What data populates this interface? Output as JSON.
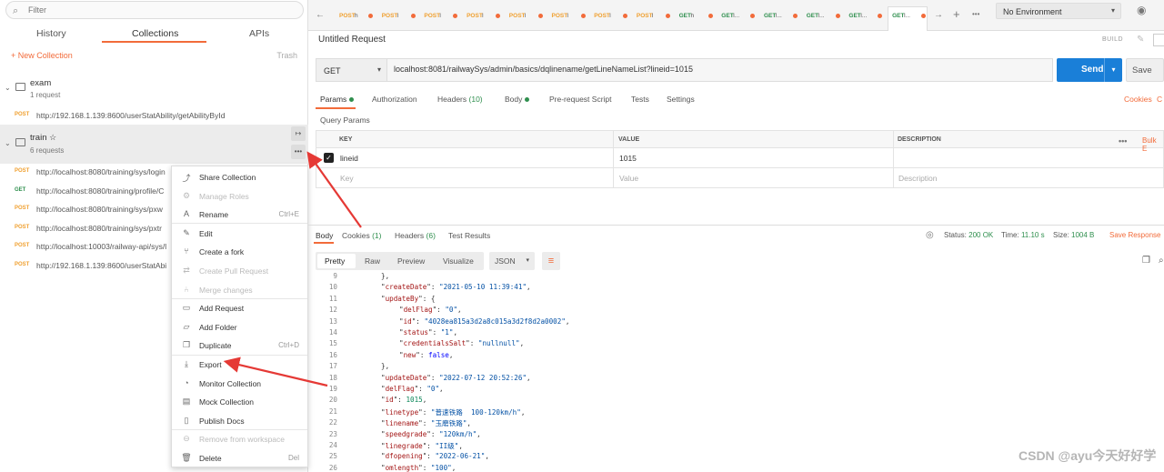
{
  "sidebar": {
    "filter_placeholder": "Filter",
    "tabs": [
      "History",
      "Collections",
      "APIs"
    ],
    "new_collection": "+ New Collection",
    "trash": "Trash",
    "collections": [
      {
        "name": "exam",
        "requests": "1 request"
      },
      {
        "name": "train",
        "star": "☆",
        "requests": "6 requests"
      }
    ],
    "exam_request": {
      "method": "POST",
      "url": "http://192.168.1.139:8600/userStatAbility/getAbilityById"
    },
    "train_requests": [
      {
        "method": "POST",
        "url": "http://localhost:8080/training/sys/login"
      },
      {
        "method": "GET",
        "url": "http://localhost:8080/training/profile/C"
      },
      {
        "method": "POST",
        "url": "http://localhost:8080/training/sys/pxw"
      },
      {
        "method": "POST",
        "url": "http://localhost:8080/training/sys/pxtr"
      },
      {
        "method": "POST",
        "url": "http://localhost:10003/railway-api/sys/l"
      },
      {
        "method": "POST",
        "url": "http://192.168.1.139:8600/userStatAbi"
      }
    ]
  },
  "context_menu": [
    {
      "label": "Share Collection",
      "icon": "share-icon",
      "glyph": "⤴",
      "shortcut": "",
      "disabled": false
    },
    {
      "label": "Manage Roles",
      "icon": "roles-icon",
      "glyph": "⚙",
      "shortcut": "",
      "disabled": true
    },
    {
      "label": "Rename",
      "icon": "rename-icon",
      "glyph": "A",
      "shortcut": "Ctrl+E",
      "disabled": false
    },
    {
      "label": "Edit",
      "icon": "pencil-icon",
      "glyph": "✎",
      "shortcut": "",
      "disabled": false
    },
    {
      "label": "Create a fork",
      "icon": "fork-icon",
      "glyph": "⑂",
      "shortcut": "",
      "disabled": false
    },
    {
      "label": "Create Pull Request",
      "icon": "pull-request-icon",
      "glyph": "⇄",
      "shortcut": "",
      "disabled": true
    },
    {
      "label": "Merge changes",
      "icon": "merge-icon",
      "glyph": "⑃",
      "shortcut": "",
      "disabled": true
    },
    {
      "label": "Add Request",
      "icon": "add-request-icon",
      "glyph": "▭",
      "shortcut": "",
      "disabled": false
    },
    {
      "label": "Add Folder",
      "icon": "add-folder-icon",
      "glyph": "▱",
      "shortcut": "",
      "disabled": false
    },
    {
      "label": "Duplicate",
      "icon": "duplicate-icon",
      "glyph": "❐",
      "shortcut": "Ctrl+D",
      "disabled": false
    },
    {
      "label": "Export",
      "icon": "export-icon",
      "glyph": "⤓",
      "shortcut": "",
      "disabled": false
    },
    {
      "label": "Monitor Collection",
      "icon": "monitor-icon",
      "glyph": "◔",
      "shortcut": "",
      "disabled": false
    },
    {
      "label": "Mock Collection",
      "icon": "mock-icon",
      "glyph": "▤",
      "shortcut": "",
      "disabled": false
    },
    {
      "label": "Publish Docs",
      "icon": "docs-icon",
      "glyph": "▯",
      "shortcut": "",
      "disabled": false
    },
    {
      "label": "Remove from workspace",
      "icon": "remove-icon",
      "glyph": "⊖",
      "shortcut": "",
      "disabled": true
    },
    {
      "label": "Delete",
      "icon": "trash-icon",
      "glyph": "🗑",
      "shortcut": "Del",
      "disabled": false
    }
  ],
  "tabs": [
    {
      "method": "POST",
      "name": "h"
    },
    {
      "method": "POST",
      "name": "l"
    },
    {
      "method": "POST",
      "name": "l"
    },
    {
      "method": "POST",
      "name": "l"
    },
    {
      "method": "POST",
      "name": "l"
    },
    {
      "method": "POST",
      "name": "l"
    },
    {
      "method": "POST",
      "name": "l"
    },
    {
      "method": "POST",
      "name": "l"
    },
    {
      "method": "GET",
      "name": "h"
    },
    {
      "method": "GET",
      "name": "l..."
    },
    {
      "method": "GET",
      "name": "l..."
    },
    {
      "method": "GET",
      "name": "l..."
    },
    {
      "method": "GET",
      "name": "l..."
    },
    {
      "method": "GET",
      "name": "l..."
    }
  ],
  "environment": "No Environment",
  "request": {
    "title": "Untitled Request",
    "build": "BUILD",
    "method": "GET",
    "url": "localhost:8081/railwaySys/admin/basics/dqlinename/getLineNameList?lineid=1015",
    "send": "Send",
    "save": "Save",
    "subtabs": [
      {
        "label": "Params",
        "count": "",
        "dot": true
      },
      {
        "label": "Authorization",
        "count": "",
        "dot": false
      },
      {
        "label": "Headers",
        "count": "(10)",
        "dot": false
      },
      {
        "label": "Body",
        "count": "",
        "dot": true
      },
      {
        "label": "Pre-request Script",
        "count": "",
        "dot": false
      },
      {
        "label": "Tests",
        "count": "",
        "dot": false
      },
      {
        "label": "Settings",
        "count": "",
        "dot": false
      }
    ],
    "cookies": "Cookies",
    "code": "C",
    "query_params_label": "Query Params",
    "columns": [
      "KEY",
      "VALUE",
      "DESCRIPTION"
    ],
    "bulk_edit": "Bulk E",
    "params": [
      {
        "key": "lineid",
        "value": "1015",
        "description": ""
      }
    ],
    "placeholders": {
      "key": "Key",
      "value": "Value",
      "description": "Description"
    }
  },
  "response": {
    "tabs": [
      {
        "label": "Body",
        "count": ""
      },
      {
        "label": "Cookies",
        "count": "(1)"
      },
      {
        "label": "Headers",
        "count": "(6)"
      },
      {
        "label": "Test Results",
        "count": ""
      }
    ],
    "status_label": "Status:",
    "status": "200 OK",
    "time_label": "Time:",
    "time": "11.10 s",
    "size_label": "Size:",
    "size": "1004 B",
    "save_response": "Save Response",
    "views": [
      "Pretty",
      "Raw",
      "Preview",
      "Visualize"
    ],
    "format": "JSON",
    "lines": [
      {
        "n": "9",
        "indent": 1,
        "text": "},"
      },
      {
        "n": "10",
        "indent": 1,
        "key": "createDate",
        "val": "\"2021-05-10 11:39:41\"",
        "type": "s"
      },
      {
        "n": "11",
        "indent": 1,
        "key": "updateBy",
        "val": "{",
        "type": "p"
      },
      {
        "n": "12",
        "indent": 2,
        "key": "delFlag",
        "val": "\"0\"",
        "type": "s"
      },
      {
        "n": "13",
        "indent": 2,
        "key": "id",
        "val": "\"4028ea815a3d2a8c015a3d2f8d2a0002\"",
        "type": "s"
      },
      {
        "n": "14",
        "indent": 2,
        "key": "status",
        "val": "\"1\"",
        "type": "s"
      },
      {
        "n": "15",
        "indent": 2,
        "key": "credentialsSalt",
        "val": "\"nullnull\"",
        "type": "s"
      },
      {
        "n": "16",
        "indent": 2,
        "key": "new",
        "val": "false",
        "type": "b"
      },
      {
        "n": "17",
        "indent": 1,
        "text": "},"
      },
      {
        "n": "18",
        "indent": 1,
        "key": "updateDate",
        "val": "\"2022-07-12 20:52:26\"",
        "type": "s"
      },
      {
        "n": "19",
        "indent": 1,
        "key": "delFlag",
        "val": "\"0\"",
        "type": "s"
      },
      {
        "n": "20",
        "indent": 1,
        "key": "id",
        "val": "1015",
        "type": "n"
      },
      {
        "n": "21",
        "indent": 1,
        "key": "linetype",
        "val": "\"普速铁路  100-120km/h\"",
        "type": "s"
      },
      {
        "n": "22",
        "indent": 1,
        "key": "linename",
        "val": "\"玉磨铁路\"",
        "type": "s"
      },
      {
        "n": "23",
        "indent": 1,
        "key": "speedgrade",
        "val": "\"120km/h\"",
        "type": "s"
      },
      {
        "n": "24",
        "indent": 1,
        "key": "linegrade",
        "val": "\"II级\"",
        "type": "s"
      },
      {
        "n": "25",
        "indent": 1,
        "key": "dfopening",
        "val": "\"2022-06-21\"",
        "type": "s"
      },
      {
        "n": "26",
        "indent": 1,
        "key": "omlength",
        "val": "\"100\"",
        "type": "s"
      }
    ]
  },
  "watermark": "CSDN @ayu今天好好学",
  "colors": {
    "accent": "#f26b3a",
    "send": "#1a7fd8",
    "post": "#f0a030",
    "get": "#2f8f4e",
    "arrow": "#e53935"
  }
}
